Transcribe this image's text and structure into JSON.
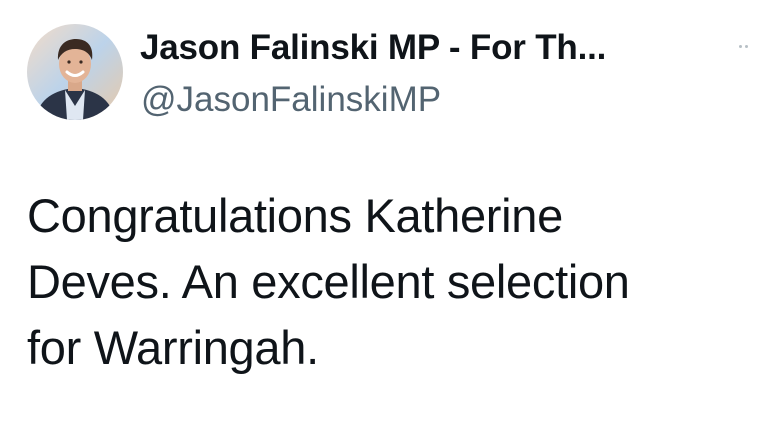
{
  "tweet": {
    "author": {
      "display_name": "Jason Falinski MP - For Th...",
      "handle": "@JasonFalinskiMP",
      "avatar_icon": "profile-photo"
    },
    "more_icon": "more-options-icon",
    "text": "Congratulations Katherine\nDeves. An excellent selection\nfor Warringah."
  },
  "colors": {
    "text": "#0f1419",
    "secondary_text": "#536471",
    "background": "#ffffff"
  }
}
